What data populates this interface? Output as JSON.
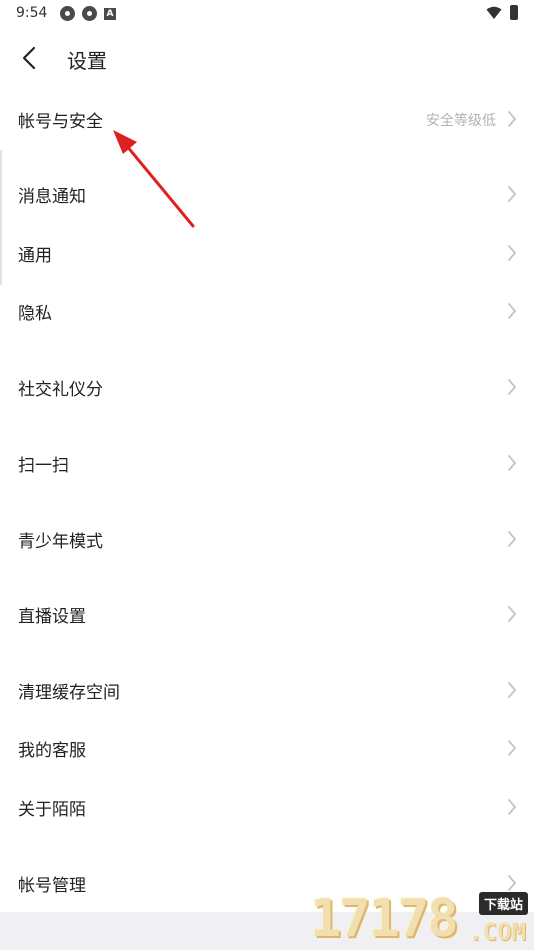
{
  "status_bar": {
    "time": "9:54",
    "icons_left": [
      "gear-icon",
      "gear-icon",
      "a-badge-icon"
    ],
    "a_badge": "A",
    "icons_right": [
      "wifi-icon",
      "battery-icon"
    ]
  },
  "header": {
    "title": "设置",
    "back_icon": "back-arrow-icon"
  },
  "settings": {
    "account_security": {
      "label": "帐号与安全",
      "status": "安全等级低"
    },
    "notifications": "消息通知",
    "general": "通用",
    "privacy": "隐私",
    "social_etiquette": "社交礼仪分",
    "scan": "扫一扫",
    "teen_mode": "青少年模式",
    "live_settings": "直播设置",
    "clear_cache": "清理缓存空间",
    "customer_service": "我的客服",
    "about": "关于陌陌",
    "account_management": "帐号管理"
  },
  "watermark": {
    "number": "17178",
    "tag": "下载站",
    "domain": ".COM"
  },
  "colors": {
    "annotation_arrow": "#e02020",
    "chevron": "#c4c4c4",
    "secondary_text": "#b3b3b3"
  }
}
